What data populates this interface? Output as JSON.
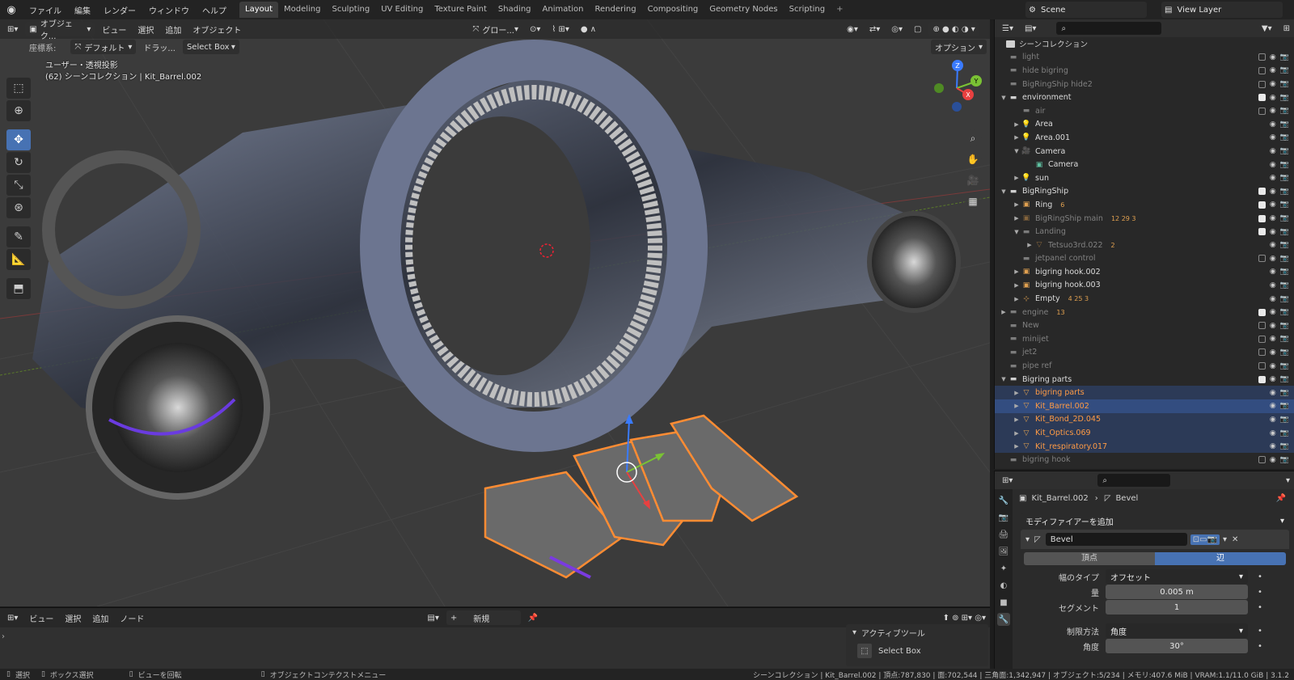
{
  "topbar": {
    "menus": [
      "ファイル",
      "編集",
      "レンダー",
      "ウィンドウ",
      "ヘルプ"
    ],
    "workspaces": [
      "Layout",
      "Modeling",
      "Sculpting",
      "UV Editing",
      "Texture Paint",
      "Shading",
      "Animation",
      "Rendering",
      "Compositing",
      "Geometry Nodes",
      "Scripting"
    ],
    "active_workspace": "Layout",
    "add_workspace": "+",
    "scene": "Scene",
    "view_layer": "View Layer"
  },
  "viewport": {
    "mode": "オブジェク...",
    "menus": [
      "ビュー",
      "選択",
      "追加",
      "オブジェクト"
    ],
    "transform": "グロー...",
    "coord_label": "座標系:",
    "coord_value": "デフォルト",
    "drag_label": "ドラッ...",
    "select_mode": "Select Box",
    "options": "オプション",
    "view_name": "ユーザー・透視投影",
    "collection_info": "(62) シーンコレクション | Kit_Barrel.002",
    "gizmo": {
      "x": "X",
      "y": "Y",
      "z": "Z"
    }
  },
  "timeline": {
    "menus": [
      "ビュー",
      "選択",
      "追加",
      "ノード"
    ],
    "new_label": "新規",
    "active_tool_title": "アクティブツール",
    "active_tool_name": "Select Box"
  },
  "outliner": {
    "root": "シーンコレクション",
    "rows": [
      {
        "name": "light",
        "type": "coll",
        "indent": 0,
        "dim": true,
        "chk": false
      },
      {
        "name": "hide bigring",
        "type": "coll",
        "indent": 0,
        "dim": true,
        "chk": false
      },
      {
        "name": "BigRingShip hide2",
        "type": "coll",
        "indent": 0,
        "dim": true,
        "chk": false
      },
      {
        "name": "environment",
        "type": "coll",
        "indent": 0,
        "open": true,
        "chk": true
      },
      {
        "name": "air",
        "type": "coll",
        "indent": 1,
        "dim": true,
        "chk": false
      },
      {
        "name": "Area",
        "type": "light",
        "indent": 1,
        "arrow": true
      },
      {
        "name": "Area.001",
        "type": "light",
        "indent": 1,
        "arrow": true
      },
      {
        "name": "Camera",
        "type": "cam",
        "indent": 1,
        "open": true
      },
      {
        "name": "Camera",
        "type": "camdata",
        "indent": 2
      },
      {
        "name": "sun",
        "type": "light",
        "indent": 1,
        "arrow": true
      },
      {
        "name": "BigRingShip",
        "type": "coll",
        "indent": 0,
        "open": true,
        "chk": true
      },
      {
        "name": "Ring",
        "type": "obj",
        "indent": 1,
        "arrow": true,
        "chk": true,
        "badge": "6"
      },
      {
        "name": "BigRingShip main",
        "type": "obj",
        "indent": 1,
        "arrow": true,
        "dim": true,
        "chk": true,
        "badge": "12 29 3"
      },
      {
        "name": "Landing",
        "type": "coll",
        "indent": 1,
        "open": true,
        "dim": true,
        "chk": true
      },
      {
        "name": "Tetsuo3rd.022",
        "type": "mesh",
        "indent": 2,
        "arrow": true,
        "dim": true,
        "badge": "2"
      },
      {
        "name": "jetpanel control",
        "type": "coll",
        "indent": 1,
        "dim": true,
        "chk": false
      },
      {
        "name": "bigring hook.002",
        "type": "obj",
        "indent": 1,
        "arrow": true
      },
      {
        "name": "bigring hook.003",
        "type": "obj",
        "indent": 1,
        "arrow": true
      },
      {
        "name": "Empty",
        "type": "empty",
        "indent": 1,
        "arrow": true,
        "badge": "4 25 3"
      },
      {
        "name": "engine",
        "type": "coll",
        "indent": 0,
        "arrow": true,
        "dim": true,
        "chk": true,
        "badge": "13"
      },
      {
        "name": "New",
        "type": "coll",
        "indent": 0,
        "dim": true,
        "chk": false
      },
      {
        "name": "minijet",
        "type": "coll",
        "indent": 0,
        "dim": true,
        "chk": false
      },
      {
        "name": "jet2",
        "type": "coll",
        "indent": 0,
        "dim": true,
        "chk": false
      },
      {
        "name": "pipe ref",
        "type": "coll",
        "indent": 0,
        "dim": true,
        "chk": false
      },
      {
        "name": "Bigring parts",
        "type": "coll",
        "indent": 0,
        "open": true,
        "chk": true
      },
      {
        "name": "bigring parts",
        "type": "mesh",
        "indent": 1,
        "arrow": true,
        "selbg": true,
        "orange": true
      },
      {
        "name": "Kit_Barrel.002",
        "type": "mesh",
        "indent": 1,
        "arrow": true,
        "sel": true,
        "orange": true
      },
      {
        "name": "Kit_Bond_2D.045",
        "type": "mesh",
        "indent": 1,
        "arrow": true,
        "selbg": true,
        "orange": true
      },
      {
        "name": "Kit_Optics.069",
        "type": "mesh",
        "indent": 1,
        "arrow": true,
        "selbg": true,
        "orange": true
      },
      {
        "name": "Kit_respiratory.017",
        "type": "mesh",
        "indent": 1,
        "arrow": true,
        "selbg": true,
        "orange": true
      },
      {
        "name": "bigring hook",
        "type": "coll",
        "indent": 0,
        "dim": true,
        "chk": false
      }
    ]
  },
  "properties": {
    "object": "Kit_Barrel.002",
    "modifier_crumb": "Bevel",
    "add_modifier": "モディファイアーを追加",
    "modifier_name": "Bevel",
    "tab_vertex": "頂点",
    "tab_edge": "辺",
    "width_type_label": "幅のタイプ",
    "width_type_value": "オフセット",
    "amount_label": "量",
    "amount_value": "0.005 m",
    "segments_label": "セグメント",
    "segments_value": "1",
    "limit_label": "制限方法",
    "limit_value": "角度",
    "angle_label": "角度",
    "angle_value": "30°"
  },
  "statusbar": {
    "select": "選択",
    "box_select": "ボックス選択",
    "rotate_view": "ビューを回転",
    "context_menu": "オブジェクトコンテクストメニュー",
    "stats": "シーンコレクション | Kit_Barrel.002 | 頂点:787,830 | 面:702,544 | 三角面:1,342,947 | オブジェクト:5/234 | メモリ:407.6 MiB | VRAM:1.1/11.0 GiB | 3.1.2"
  },
  "colors": {
    "accent": "#4772b3",
    "selected": "#ff8c33",
    "bg": "#3b3b3b"
  }
}
